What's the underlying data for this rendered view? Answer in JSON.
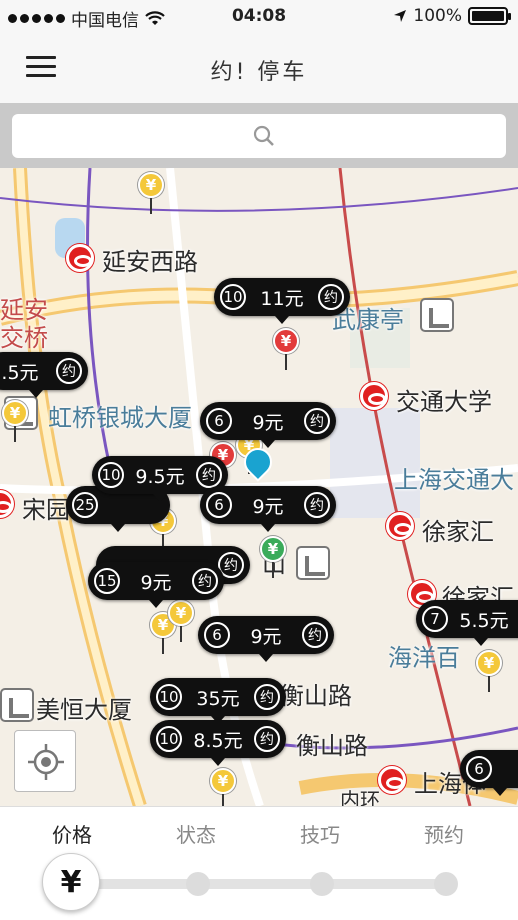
{
  "status_bar": {
    "carrier": "中国电信",
    "time": "04:08",
    "battery": "100%"
  },
  "nav": {
    "title": "约! 停车",
    "menu_icon": "hamburger-icon"
  },
  "search": {
    "placeholder": "",
    "icon": "search-icon"
  },
  "map": {
    "labels": [
      "延安西路",
      "延安",
      "交桥",
      "虹桥银城大厦",
      "宋园",
      "武康亭",
      "交通大学",
      "上海交通大",
      "徐家汇",
      "徐家汇",
      "海洋百",
      "美恒大厦",
      "衡山路",
      "衡山路",
      "上海体",
      "山",
      "内环"
    ],
    "parking_spots": [
      {
        "count": "10",
        "price": "11元",
        "action": "约"
      },
      {
        "count": "",
        "price": ".5元",
        "action": "约"
      },
      {
        "count": "6",
        "price": "9元",
        "action": "约"
      },
      {
        "count": "10",
        "price": "9.5元",
        "action": "约"
      },
      {
        "count": "25",
        "price": "",
        "action": ""
      },
      {
        "count": "6",
        "price": "9元",
        "action": "约"
      },
      {
        "count": "",
        "price": "",
        "action": "约"
      },
      {
        "count": "15",
        "price": "9元",
        "action": "约"
      },
      {
        "count": "6",
        "price": "9元",
        "action": "约"
      },
      {
        "count": "7",
        "price": "5.5元",
        "action": ""
      },
      {
        "count": "10",
        "price": "35元",
        "action": "约"
      },
      {
        "count": "10",
        "price": "8.5元",
        "action": "约"
      },
      {
        "count": "6",
        "price": "",
        "action": ""
      }
    ],
    "pin_symbol": "¥"
  },
  "tabs": [
    {
      "label": "价格",
      "active": true
    },
    {
      "label": "状态",
      "active": false
    },
    {
      "label": "技巧",
      "active": false
    },
    {
      "label": "预约",
      "active": false
    }
  ],
  "slider_symbol": "¥",
  "colors": {
    "pill": "#101010",
    "metro": "#e02020",
    "pin_yellow": "#f4c83a",
    "location": "#1aa3d0"
  }
}
